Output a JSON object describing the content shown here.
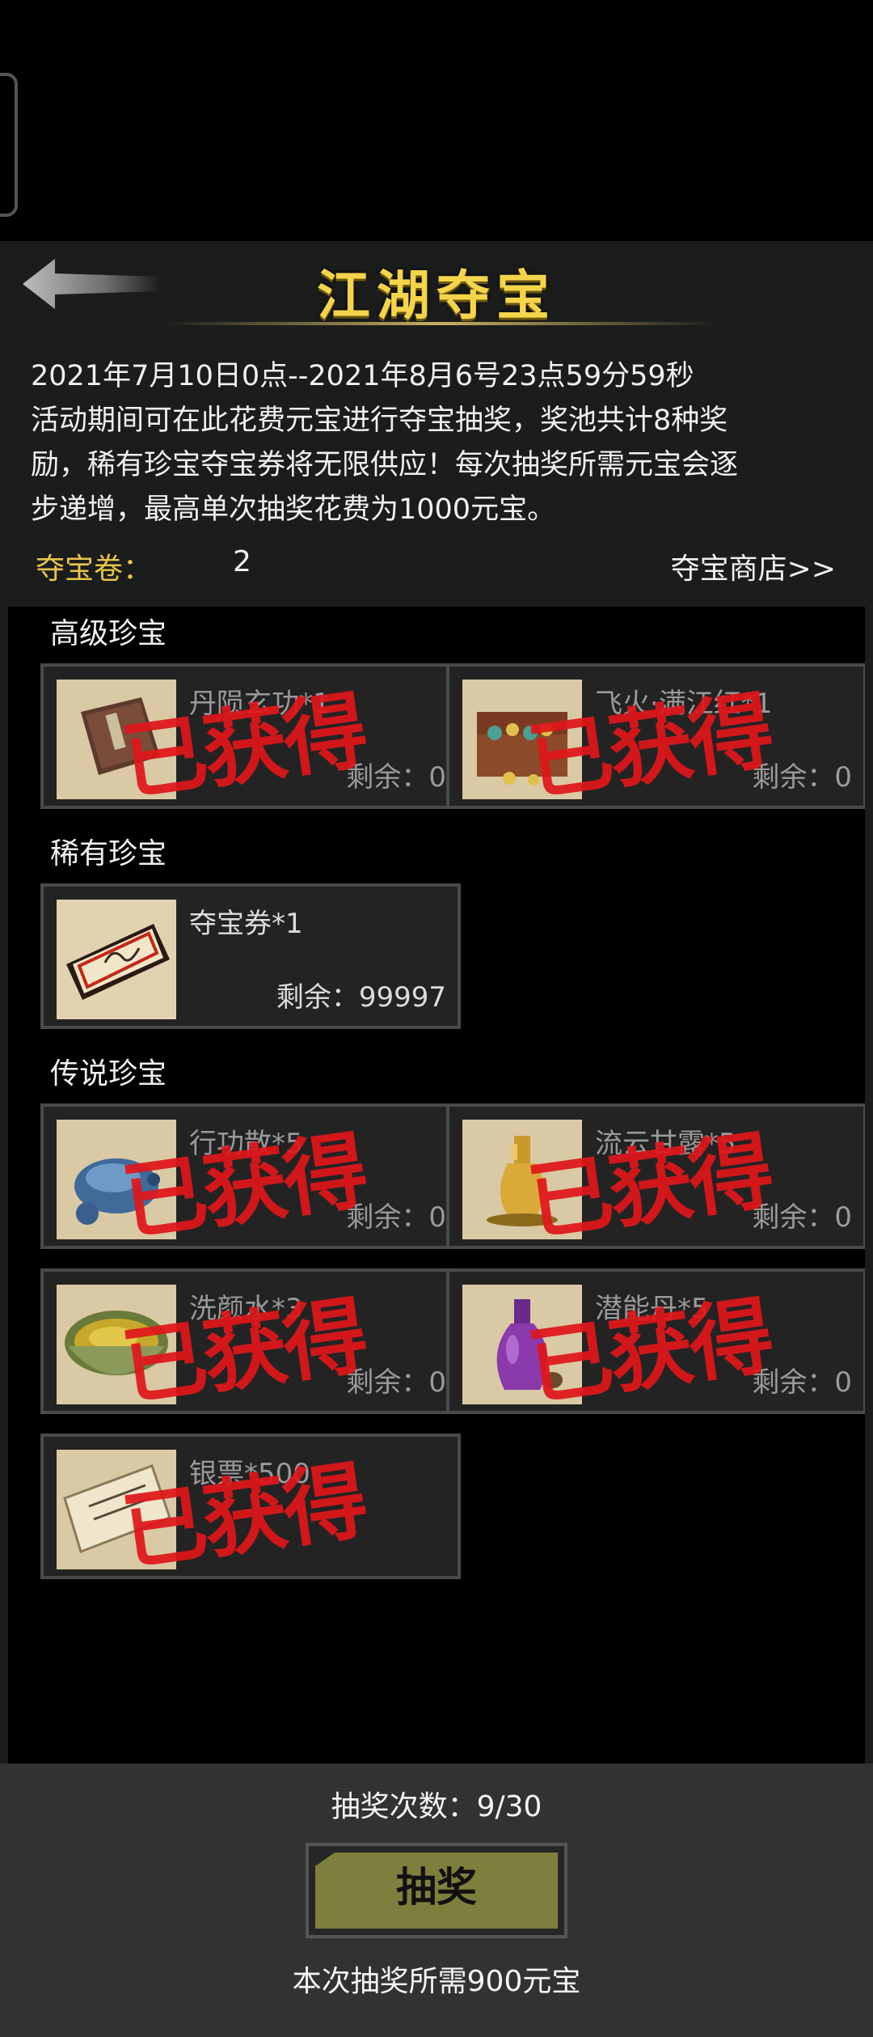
{
  "header": {
    "title": "江湖夺宝",
    "back_icon": "back-arrow-icon"
  },
  "description": {
    "line1": "2021年7月10日0点--2021年8月6号23点59分59秒",
    "line2": "活动期间可在此花费元宝进行夺宝抽奖，奖池共计8种奖",
    "line3": "励，稀有珍宝夺宝券将无限供应！每次抽奖所需元宝会逐",
    "line4": "步递增，最高单次抽奖花费为1000元宝。"
  },
  "tickets": {
    "label": "夺宝卷：",
    "value": "2",
    "shop_link": "夺宝商店>>"
  },
  "stamp_text": "已获得",
  "sections": {
    "advanced": {
      "title": "高级珍宝",
      "items": [
        {
          "name": "丹陨玄功*1",
          "remaining": "剩余：0",
          "icon": "book-icon",
          "obtained": true
        },
        {
          "name": "飞火·满江红*1",
          "remaining": "剩余：0",
          "icon": "treasure-chest-icon",
          "obtained": true
        }
      ]
    },
    "rare": {
      "title": "稀有珍宝",
      "items": [
        {
          "name": "夺宝券*1",
          "remaining": "剩余：99997",
          "icon": "ticket-icon",
          "obtained": false
        }
      ]
    },
    "legendary": {
      "title": "传说珍宝",
      "items": [
        {
          "name": "行功散*5",
          "remaining": "剩余：0",
          "icon": "blue-pouch-icon",
          "obtained": true
        },
        {
          "name": "流云甘露*5",
          "remaining": "剩余：0",
          "icon": "golden-vase-icon",
          "obtained": true
        },
        {
          "name": "洗颜水*3",
          "remaining": "剩余：0",
          "icon": "bowl-icon",
          "obtained": true
        },
        {
          "name": "潜能丹*5",
          "remaining": "剩余：0",
          "icon": "purple-bottle-icon",
          "obtained": true
        },
        {
          "name": "银票*500",
          "remaining": "",
          "icon": "banknote-icon",
          "obtained": true
        }
      ]
    }
  },
  "footer": {
    "draw_count": "抽奖次数：9/30",
    "draw_button": "抽奖",
    "cost_note": "本次抽奖所需900元宝"
  },
  "colors": {
    "title": "#f4d44a",
    "ticket_label": "#e7c54a",
    "stamp": "#e0161a",
    "draw_button": "#7e7f3d"
  }
}
